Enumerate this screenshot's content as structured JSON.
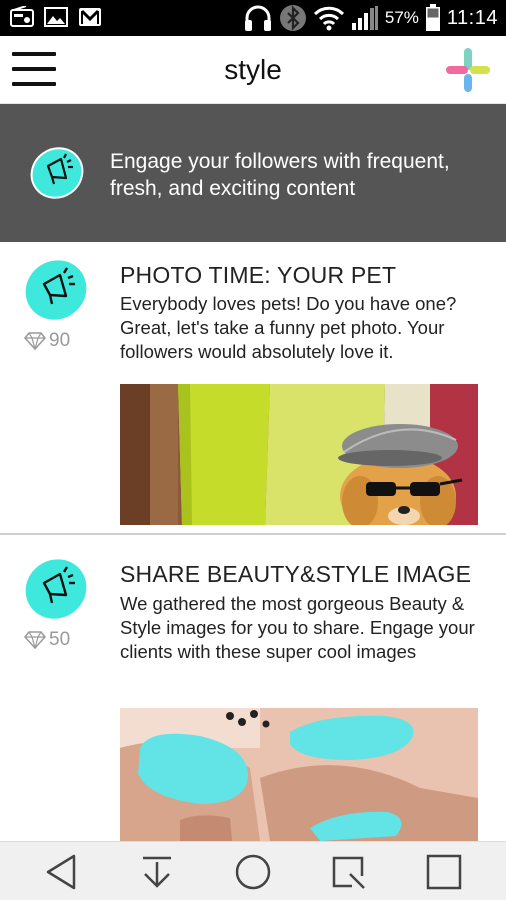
{
  "status_bar": {
    "battery_percent": "57%",
    "time": "11:14",
    "icons": [
      "radio-icon",
      "image-icon",
      "gmail-icon",
      "headphones-icon",
      "bluetooth-icon",
      "wifi-icon",
      "signal-icon",
      "battery-icon"
    ]
  },
  "app_bar": {
    "title": "style",
    "menu_icon": "hamburger-menu-icon",
    "logo_icon": "app-logo-icon"
  },
  "banner": {
    "text": "Engage your followers with frequent, fresh, and exciting content",
    "icon": "megaphone-icon"
  },
  "cards": [
    {
      "title": "PHOTO TIME: YOUR PET",
      "description": "Everybody loves pets! Do you have one? Great, let's take a funny pet photo. Your followers would absolutely love it.",
      "points": "90",
      "icon": "megaphone-icon",
      "image": "pet-photo"
    },
    {
      "title": "SHARE BEAUTY&STYLE IMAGE",
      "description": "We gathered the most gorgeous Beauty & Style images for you to share. Engage your clients with these super cool images",
      "points": "50",
      "icon": "megaphone-icon",
      "image": "nails-photo"
    }
  ],
  "nav_bar": {
    "buttons": [
      "back-icon",
      "download-icon",
      "home-icon",
      "capture-icon",
      "recents-icon"
    ]
  },
  "colors": {
    "accent_teal": "#3ee8dc",
    "banner_bg": "#555555",
    "logo_pink": "#f06aa0",
    "logo_green": "#7fd2c2",
    "logo_yellow": "#d6e04a",
    "logo_blue": "#6ab6ea"
  }
}
